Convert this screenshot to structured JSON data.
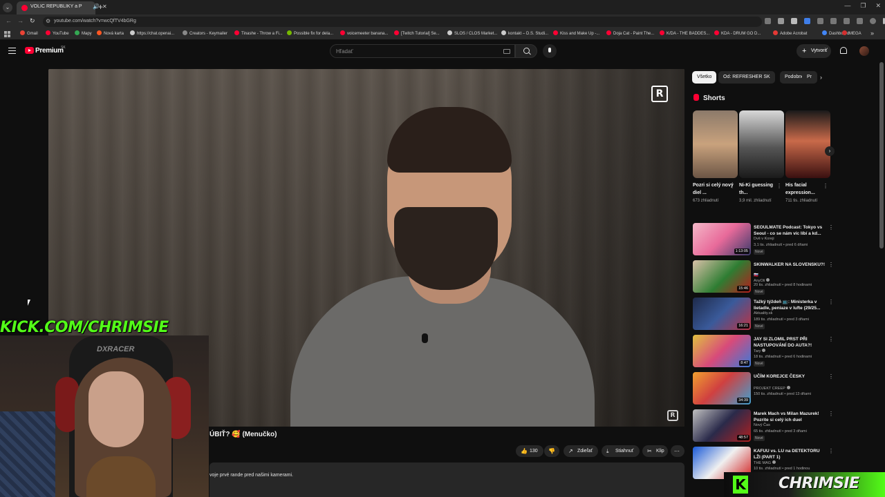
{
  "browser": {
    "tab_title": "VOLIČ REPUBLIKY a PS-ka...",
    "url": "youtube.com/watch?v=wcQfTV4bGRg",
    "bookmarks": [
      "Gmail",
      "YouTube",
      "Mapy",
      "Nová karta",
      "https://chat.openai...",
      "Creators - Keymailer",
      "Tinashe - Throw a Fi...",
      "Possible fix for dela...",
      "voicemeeter banana...",
      "[Twitch Tutorial] Se...",
      "SLOS / CLOS Market...",
      "kontakt – D.S. Studi...",
      "Kiss and Make Up -...",
      "Doja Cat - Paint The...",
      "K/DA - THE BADDES...",
      "KDA - DRUM GO D...",
      "Adobe Acrobat",
      "Dashboard",
      "MEGA"
    ],
    "bookmark_colors": [
      "#ea4335",
      "#ff0033",
      "#34a853",
      "#ff5722",
      "#cccccc",
      "#888888",
      "#ff0033",
      "#76b900",
      "#ff0033",
      "#ff0033",
      "#cccccc",
      "#cccccc",
      "#ff0033",
      "#ff0033",
      "#ff0033",
      "#ff0033",
      "#e53935",
      "#4285f4",
      "#d32f2f"
    ]
  },
  "header": {
    "brand": "Premium",
    "country": "SK",
    "search_placeholder": "Hľadať",
    "create_label": "Vytvoriť"
  },
  "video": {
    "title": "ÚBIŤ? 🥰 (Menučko)",
    "likes": "130",
    "share_label": "Zdieľať",
    "download_label": "Stiahnuť",
    "clip_label": "Klip",
    "description": "voje prvé rande pred našimi kamerami."
  },
  "chips": [
    "Všetko",
    "Od: REFRESHER SK",
    "Podobné",
    "Pr"
  ],
  "shorts": {
    "heading": "Shorts",
    "items": [
      {
        "title": "Pozri si celý nový diel ...",
        "views": "673 zhliadnutí"
      },
      {
        "title": "Ni-Ki guessing th...",
        "views": "3,9 mil. zhliadnutí"
      },
      {
        "title": "His facial expression...",
        "views": "711 tis. zhliadnutí"
      }
    ]
  },
  "recommendations": [
    {
      "title": "SEOULMATE Podcast: Tokyo vs Seoul - co se nám víc líbí a kd...",
      "channel": "Dvě v Koreji",
      "meta": "3,1 tis. zhliadnutí • pred 6 dňami",
      "badge": "Nové",
      "duration": "1:13:05",
      "verified": false
    },
    {
      "title": "SKINWALKER NA SLOVENSKU?!",
      "channel": "🇸🇰",
      "meta": "20 tis. zhliadnutí • pred 8 hodinami",
      "badge": "Nové",
      "duration": "15:46",
      "verified": false,
      "channel2": "AnyOli"
    },
    {
      "title": "Tažký týždeň 📺: Ministerka v lietadle, peniaze v lufte (29/25...",
      "channel": "Aktuality.sk",
      "meta": "189 tis. zhliadnutí • pred 3 dňami",
      "badge": "Nové",
      "duration": "16:21",
      "verified": false
    },
    {
      "title": "JAY SI ZLOMIL PRST PŘI NASTUPOVÁNÍ DO AUTA?!",
      "channel": "Tary",
      "meta": "18 tis. zhliadnutí • pred 6 hodinami",
      "badge": "Nové",
      "duration": "8:47",
      "verified": true
    },
    {
      "title": "UČÍM KOREJCE ČESKY",
      "channel": "PROJEKT CREEP",
      "meta": "150 tis. zhliadnutí • pred 13 dňami",
      "badge": "",
      "duration": "34:39",
      "verified": true
    },
    {
      "title": "Marek Mach vs Milan Mazurek! Pozrite si celý ich duel",
      "channel": "Nový Čas",
      "meta": "65 tis. zhliadnutí • pred 3 dňami",
      "badge": "Nové",
      "duration": "48:57",
      "verified": false
    },
    {
      "title": "KAFUU vs. LU na DETEKTORU LŽI (PART 1)",
      "channel": "THE MAG",
      "meta": "10 tis. zhliadnutí • pred 1 hodinou",
      "badge": "",
      "duration": "",
      "verified": true
    }
  ],
  "overlay": {
    "kick_label": "KICK.COM/CHRIMSIE",
    "streamer_name": "CHRIMSIE",
    "kick_letter": "K",
    "chair_brand": "DXRACER",
    "watermark": "R",
    "accent": "#53fc18"
  }
}
